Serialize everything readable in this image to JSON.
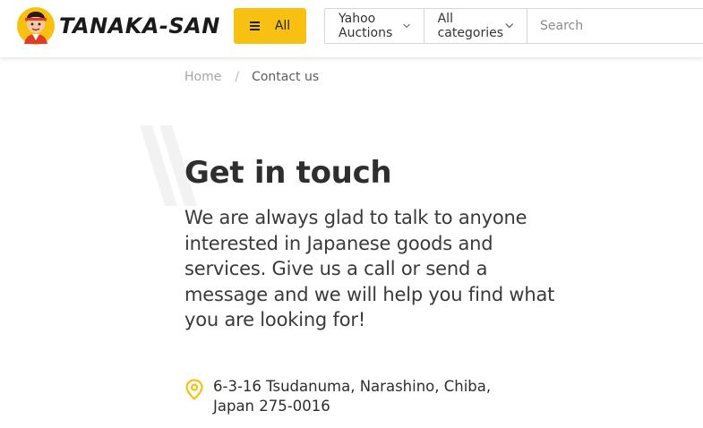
{
  "header": {
    "logo_text": "TANAKA-SAN",
    "all_button_label": "All",
    "site_select": {
      "selected": "Yahoo Auctions"
    },
    "category_select": {
      "selected": "All categories"
    },
    "search": {
      "placeholder": "Search",
      "value": ""
    }
  },
  "breadcrumb": {
    "home": "Home",
    "separator": "/",
    "current": "Contact us"
  },
  "content": {
    "title": "Get in touch",
    "intro": "We are always glad to talk to anyone interested in Japanese goods and services. Give us a call or send a message and we will help you find what you are looking for!",
    "address_line1": "6-3-16 Tsudanuma, Narashino, Chiba,",
    "address_line2": "Japan 275-0016"
  },
  "icons": {
    "menu": "hamburger-icon",
    "dropdown": "chevron-down-icon",
    "address": "map-pin-icon"
  },
  "colors": {
    "accent": "#f8c010",
    "text": "#2e2e2e",
    "muted": "#a6a6a6"
  }
}
